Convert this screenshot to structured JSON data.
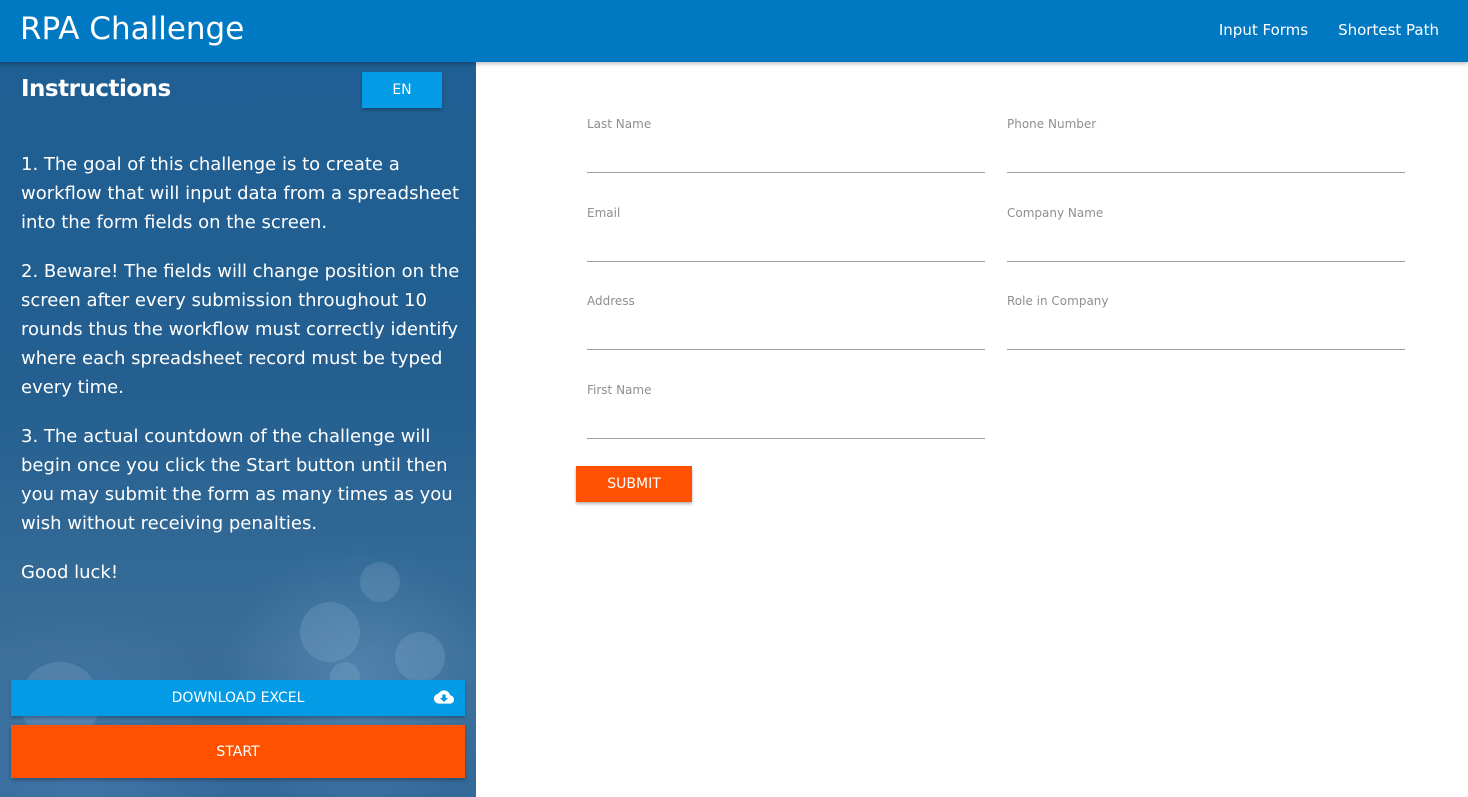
{
  "navbar": {
    "brand": "RPA Challenge",
    "links": [
      "Input Forms",
      "Shortest Path"
    ]
  },
  "sidebar": {
    "title": "Instructions",
    "language_button": "EN",
    "paragraphs": [
      "1. The goal of this challenge is to create a workflow that will input data from a spreadsheet into the form fields on the screen.",
      "2. Beware! The fields will change position on the screen after every submission throughout 10 rounds thus the workflow must correctly identify where each spreadsheet record must be typed every time.",
      "3. The actual countdown of the challenge will begin once you click the Start button until then you may submit the form as many times as you wish without receiving penalties.",
      "Good luck!"
    ],
    "download_button": "DOWNLOAD EXCEL",
    "download_icon": "cloud-download-icon",
    "start_button": "START"
  },
  "form": {
    "fields": [
      {
        "label": "Last Name",
        "value": ""
      },
      {
        "label": "Phone Number",
        "value": ""
      },
      {
        "label": "Email",
        "value": ""
      },
      {
        "label": "Company Name",
        "value": ""
      },
      {
        "label": "Address",
        "value": ""
      },
      {
        "label": "Role in Company",
        "value": ""
      },
      {
        "label": "First Name",
        "value": ""
      }
    ],
    "submit_button": "SUBMIT"
  },
  "colors": {
    "navbar": "#0079c2",
    "accent_blue": "#039be5",
    "accent_orange": "#ff5100"
  }
}
